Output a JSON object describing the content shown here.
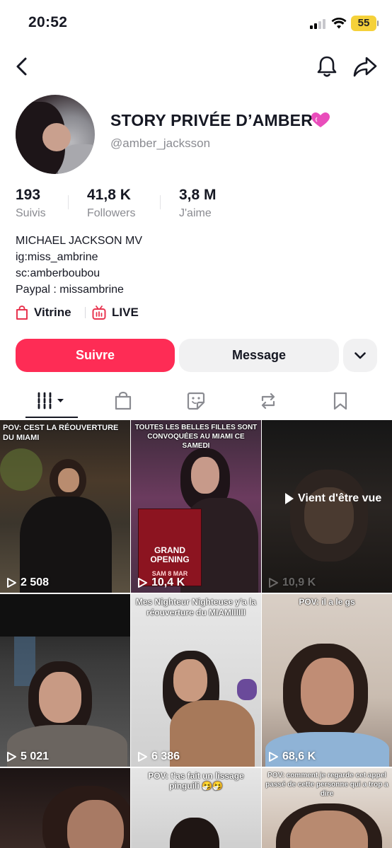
{
  "status_bar": {
    "time": "20:52",
    "battery": "55"
  },
  "profile": {
    "display_name": "STORY PRIVÉE D’AMBER",
    "username": "@amber_jacksson",
    "stats": [
      {
        "value": "193",
        "label": "Suivis"
      },
      {
        "value": "41,8 K",
        "label": "Followers"
      },
      {
        "value": "3,8 M",
        "label": "J'aime"
      }
    ],
    "bio": [
      "MICHAEL JACKSON MV",
      "ig:miss_ambrine",
      "sc:amberboubou",
      "Paypal : missambrine"
    ],
    "links": {
      "shop": "Vitrine",
      "live": "LIVE"
    }
  },
  "actions": {
    "follow": "Suivre",
    "message": "Message"
  },
  "tabs": [
    "videos-icon",
    "shop-icon",
    "stickers-icon",
    "repost-icon",
    "bookmark-icon"
  ],
  "videos": [
    {
      "caption": "POV: CEST LA RÉOUVERTURE DU MIAMI",
      "views": "2 508"
    },
    {
      "caption": "TOUTES LES BELLES FILLES SONT CONVOQUÉES AU MIAMI CE SAMEDI",
      "views": "10,4 K",
      "poster": "GRAND OPENING",
      "poster_date": "SAM 8 MAR"
    },
    {
      "caption": "",
      "views": "10,9 K",
      "overlay": "Vient d'être vue"
    },
    {
      "caption": "",
      "views": "5 021"
    },
    {
      "caption": "Mes Nighteur Nighteuse y'a la réouverture du MIAMIIIIII",
      "views": "6 386"
    },
    {
      "caption": "POV: il a le gs",
      "views": "68,6 K"
    },
    {
      "caption": "",
      "views": ""
    },
    {
      "caption": "POV: t'as fait un lissage pinguili 🤧🤧",
      "views": ""
    },
    {
      "caption": "POV: comment je regarde cet appel passé de cette personne qui a trop a dire",
      "views": ""
    }
  ],
  "colors": {
    "accent": "#fe2c55",
    "text": "#161823",
    "muted": "#8a8b91",
    "button_bg": "#f1f1f2"
  }
}
